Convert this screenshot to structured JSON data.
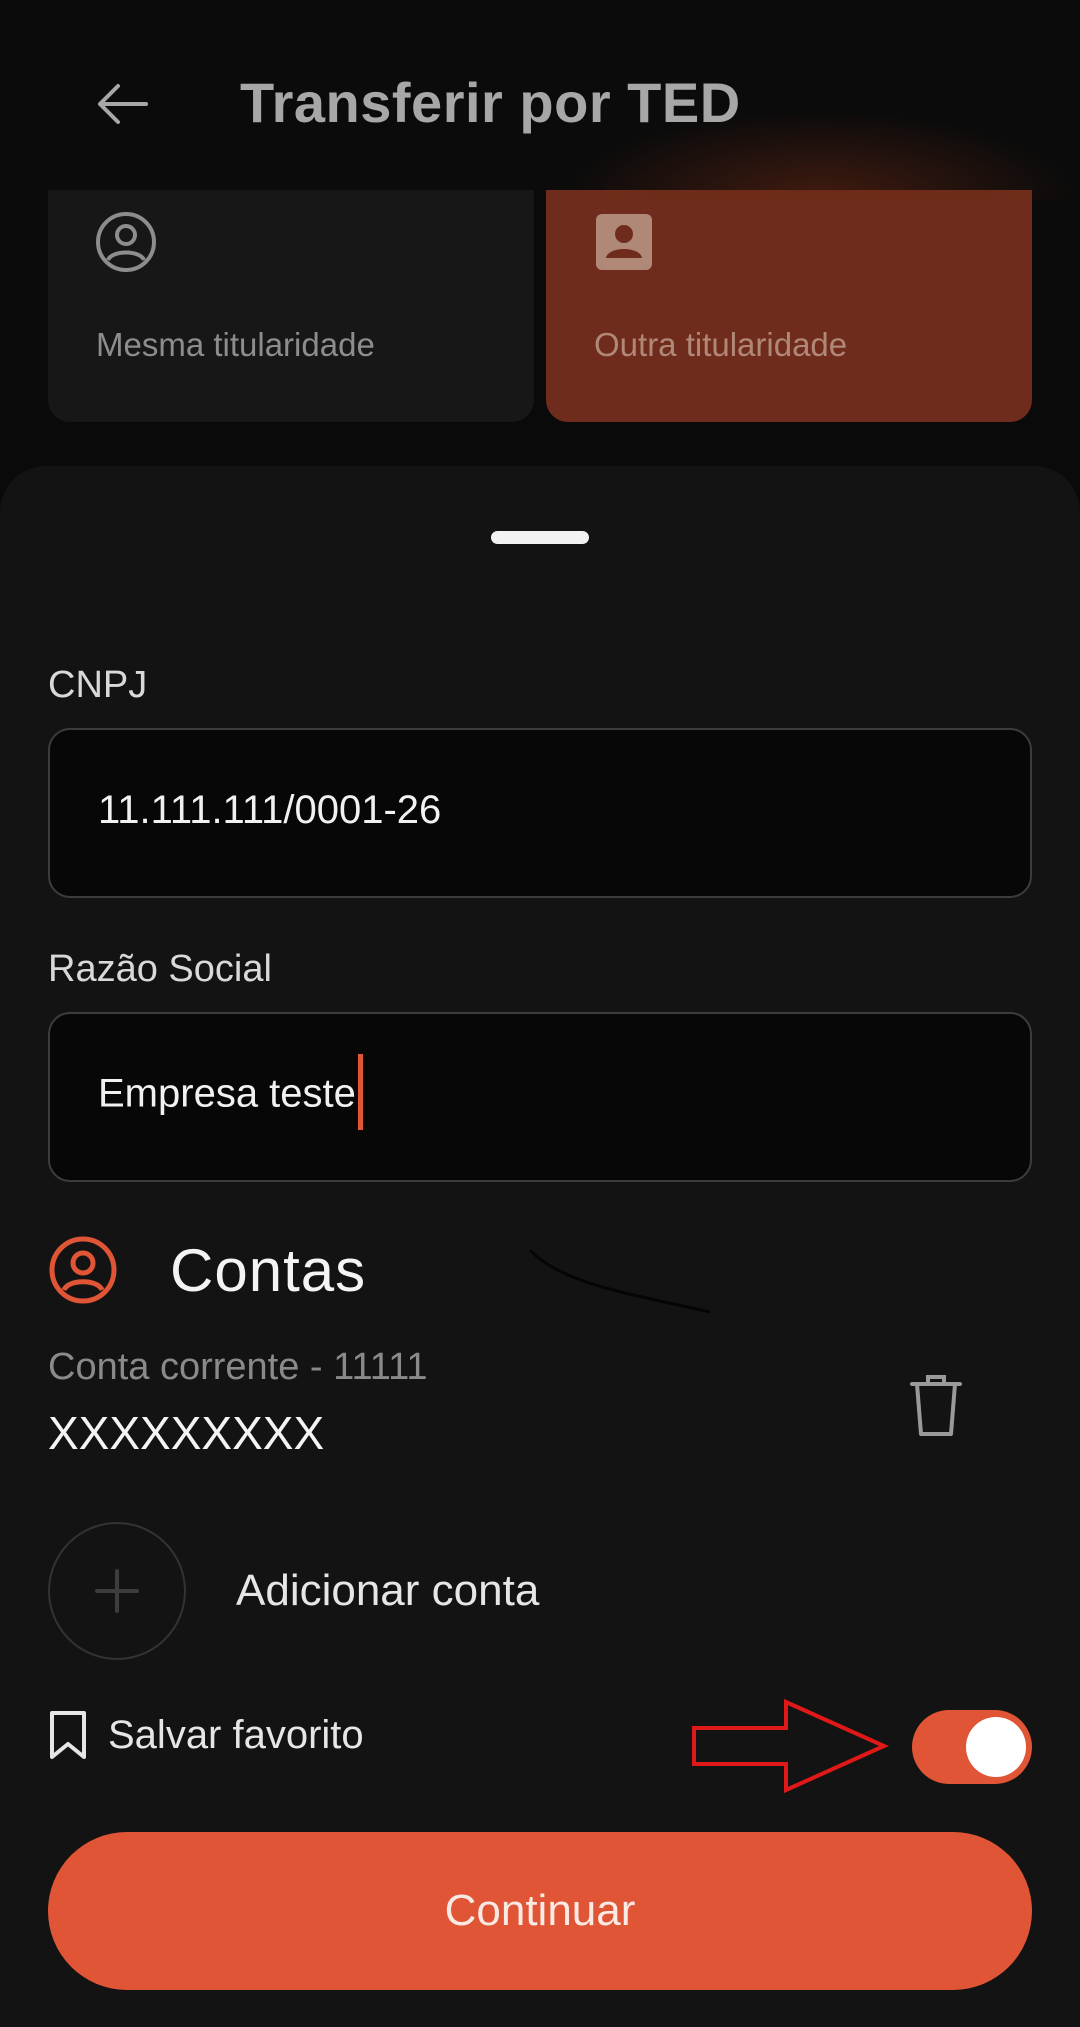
{
  "header": {
    "title": "Transferir por TED",
    "back_icon": "arrow-left-icon"
  },
  "ownership_options": [
    {
      "label": "Mesma titularidade",
      "icon": "person-circle-icon",
      "selected": false
    },
    {
      "label": "Outra titularidade",
      "icon": "person-badge-icon",
      "selected": true
    }
  ],
  "form": {
    "cnpj_label": "CNPJ",
    "cnpj_value": "11.111.111/0001-26",
    "razao_label": "Razão Social",
    "razao_value": "Empresa teste"
  },
  "accounts": {
    "section_title": "Contas",
    "items": [
      {
        "type": "Conta corrente - 11111",
        "number": "XXXXXXXXX"
      }
    ],
    "add_label": "Adicionar conta"
  },
  "favorite": {
    "label": "Salvar favorito",
    "enabled": true
  },
  "actions": {
    "continue_label": "Continuar"
  },
  "colors": {
    "accent": "#e05535",
    "selected_card": "#6f2c1c",
    "background": "#131313"
  }
}
